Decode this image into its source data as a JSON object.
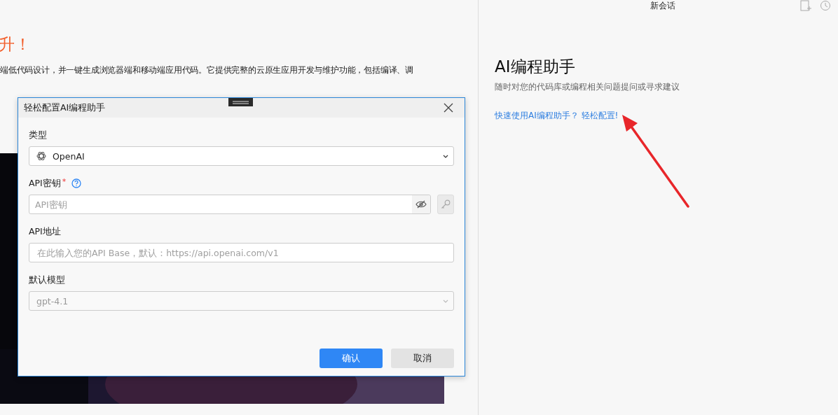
{
  "left_page": {
    "heading": "升！",
    "paragraph": "端低代码设计，并一键生成浏览器端和移动端应用代码。它提供完整的云原生应用开发与维护功能，包括编译、调"
  },
  "dialog": {
    "title": "轻松配置AI编程助手",
    "fields": [
      {
        "kind": "select",
        "label": "类型",
        "value": "OpenAI",
        "disabled": false
      },
      {
        "kind": "password",
        "label": "API密钥",
        "required_mark": "*",
        "placeholder": "API密钥"
      },
      {
        "kind": "text",
        "label": "API地址",
        "placeholder": "在此输入您的API Base，默认：https://api.openai.com/v1"
      },
      {
        "kind": "select",
        "label": "默认模型",
        "value": "gpt-4.1",
        "disabled": true
      }
    ],
    "buttons": [
      {
        "label": "确认",
        "kind": "primary"
      },
      {
        "label": "取消",
        "kind": "secondary"
      }
    ]
  },
  "assistant_panel": {
    "title": "新会话",
    "heading": "AI编程助手",
    "subtitle": "随时对您的代码库或编程相关问题提问或寻求建议",
    "link": "快速使用AI编程助手？ 轻松配置!"
  }
}
